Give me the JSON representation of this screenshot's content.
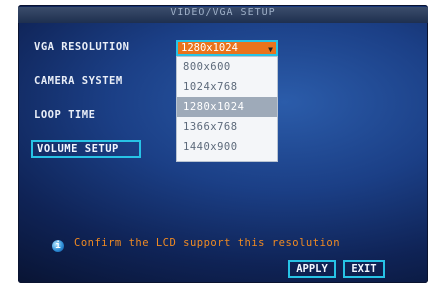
{
  "title": "VIDEO/VGA SETUP",
  "labels": {
    "vga_resolution": "VGA RESOLUTION",
    "camera_system": "CAMERA SYSTEM",
    "loop_time": "LOOP TIME"
  },
  "vga_select": {
    "value": "1280x1024",
    "options": [
      "800x600",
      "1024x768",
      "1280x1024",
      "1366x768",
      "1440x900"
    ],
    "highlighted_index": 2
  },
  "volume_button": "VOLUME SETUP",
  "info": {
    "icon": "info-icon",
    "message": "Confirm the LCD support this resolution"
  },
  "buttons": {
    "apply": "APPLY",
    "exit": "EXIT"
  },
  "colors": {
    "accent_border": "#27c3e6",
    "selected_field": "#e9731c",
    "message_text": "#f08a22"
  }
}
